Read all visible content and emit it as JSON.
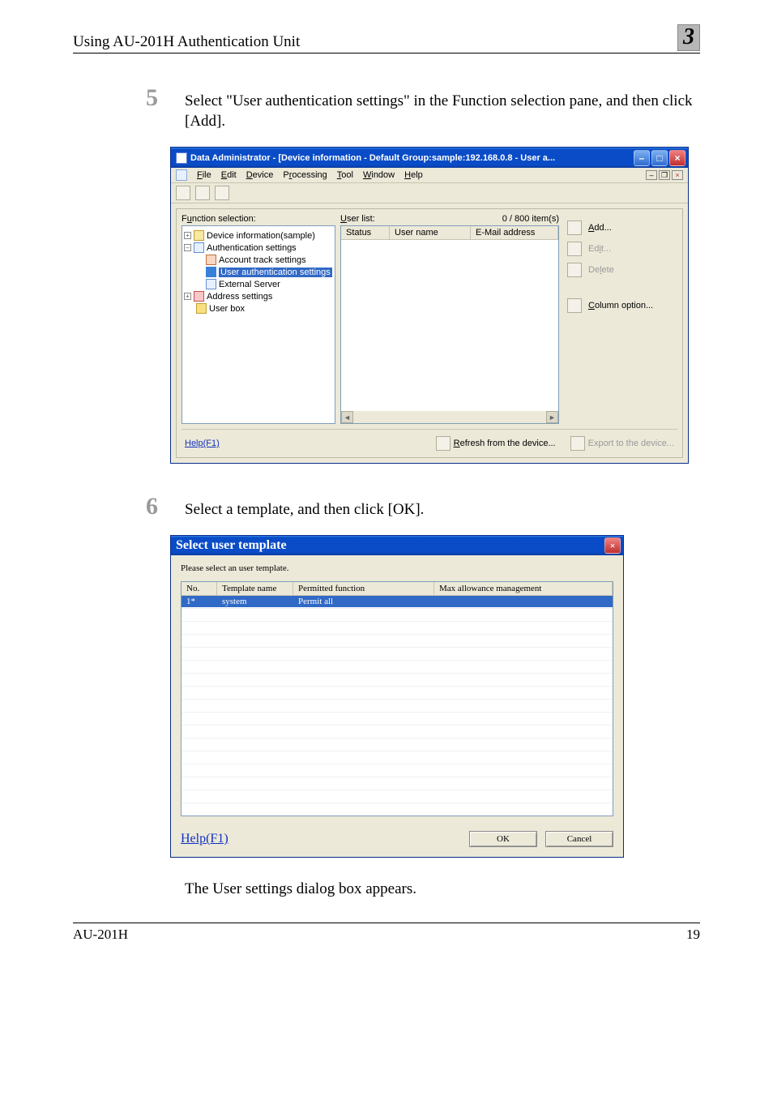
{
  "header": {
    "title": "Using AU-201H Authentication Unit",
    "chapter": "3"
  },
  "step5": {
    "num": "5",
    "text": "Select \"User authentication settings\" in the Function selection pane, and then click [Add]."
  },
  "win1": {
    "title": "Data Administrator - [Device information - Default Group:sample:192.168.0.8 - User a...",
    "menus": [
      "File",
      "Edit",
      "Device",
      "Processing",
      "Tool",
      "Window",
      "Help"
    ],
    "func_label": "Function selection:",
    "userlist_label": "User list:",
    "item_count": "0 / 800 item(s)",
    "list_cols": [
      "Status",
      "User name",
      "E-Mail address"
    ],
    "tree": {
      "device": "Device information(sample)",
      "auth": "Authentication settings",
      "acct": "Account track settings",
      "user": "User authentication settings",
      "ext": "External Server",
      "addr": "Address settings",
      "box": "User box"
    },
    "side": {
      "add": "Add...",
      "edit": "Edit...",
      "del": "Delete",
      "col": "Column option..."
    },
    "bottom": {
      "help": "Help(F1)",
      "refresh": "Refresh from the device...",
      "export": "Export to the device..."
    }
  },
  "step6": {
    "num": "6",
    "text": "Select a template, and then click [OK]."
  },
  "dlg": {
    "title": "Select user template",
    "instr": "Please select an user template.",
    "cols": {
      "no": "No.",
      "tmpl": "Template name",
      "perm": "Permitted function",
      "max": "Max allowance management"
    },
    "row": {
      "no": "1*",
      "tmpl": "system",
      "perm": "Permit all",
      "max": ""
    },
    "help": "Help(F1)",
    "ok": "OK",
    "cancel": "Cancel"
  },
  "after6": "The User settings dialog box appears.",
  "footer": {
    "left": "AU-201H",
    "right": "19"
  }
}
